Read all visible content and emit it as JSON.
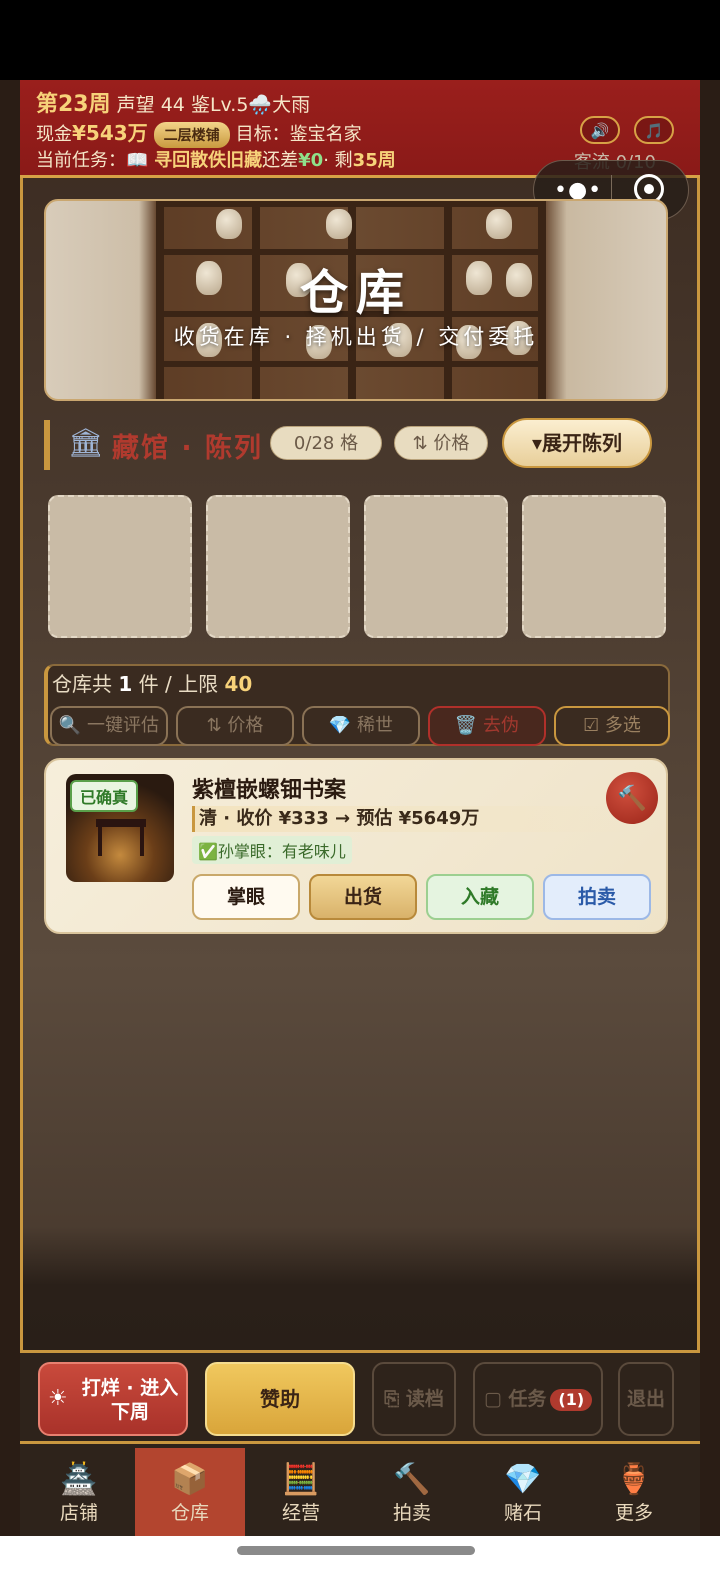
{
  "header": {
    "week": "第23周",
    "reputation": "声望 44",
    "appraise_level": "鉴Lv.5",
    "weather": "🌧️大雨",
    "cash_label": "现金",
    "cash_value": "¥543万",
    "floor_badge": "二层楼铺",
    "goal": "目标：鉴宝名家",
    "task_label": "当前任务：",
    "task_icon": "📖",
    "task_name": "寻回散佚旧藏",
    "task_diff_label": "还差",
    "task_diff_value": "¥0",
    "task_remain_label": "· 剩",
    "task_remain_value": "35周",
    "traffic": "客流 0/10",
    "sound_icon": "🔊",
    "music_icon": "🎵"
  },
  "banner": {
    "title": "仓库",
    "subtitle": "收货在库 · 择机出货 / 交付委托"
  },
  "museum": {
    "icon": "🏛",
    "label": "藏馆 · 陈列",
    "slots_chip": "0/28 格",
    "sort_chip": "⇅ 价格",
    "expand_button": "▾展开陈列"
  },
  "warehouse": {
    "count_prefix": "仓库共 ",
    "count": "1",
    "count_mid": " 件 / 上限 ",
    "limit": "40",
    "tools": [
      "🔍 一键评估",
      "⇅ 价格",
      "💎 稀世",
      "🗑️ 去伪",
      "☑ 多选"
    ]
  },
  "item": {
    "badge": "已确真",
    "name": "紫檀嵌螺钿书案",
    "price_line": "清 · 收价 ¥333 → 预估 ¥5649万",
    "note": "✅孙掌眼：有老味儿",
    "hammer_icon": "🔨",
    "actions": [
      "掌眼",
      "出货",
      "入藏",
      "拍卖"
    ]
  },
  "actionbar": {
    "close_shop": "打烊 · 进入下周",
    "sponsor": "赞助",
    "load": "⎘ 读档",
    "tasks": "▢ 任务",
    "tasks_count": "(1)",
    "exit": "退出"
  },
  "tabs": [
    {
      "label": "店铺",
      "icon": "🏯"
    },
    {
      "label": "仓库",
      "icon": "📦"
    },
    {
      "label": "经营",
      "icon": "🧮"
    },
    {
      "label": "拍卖",
      "icon": "🔨"
    },
    {
      "label": "赌石",
      "icon": "💎"
    },
    {
      "label": "更多",
      "icon": "🏺"
    }
  ],
  "active_tab": "仓库",
  "colors": {
    "header_red": "#9a1f1c",
    "gold": "#c9973f",
    "active_tab": "#b3452f"
  }
}
